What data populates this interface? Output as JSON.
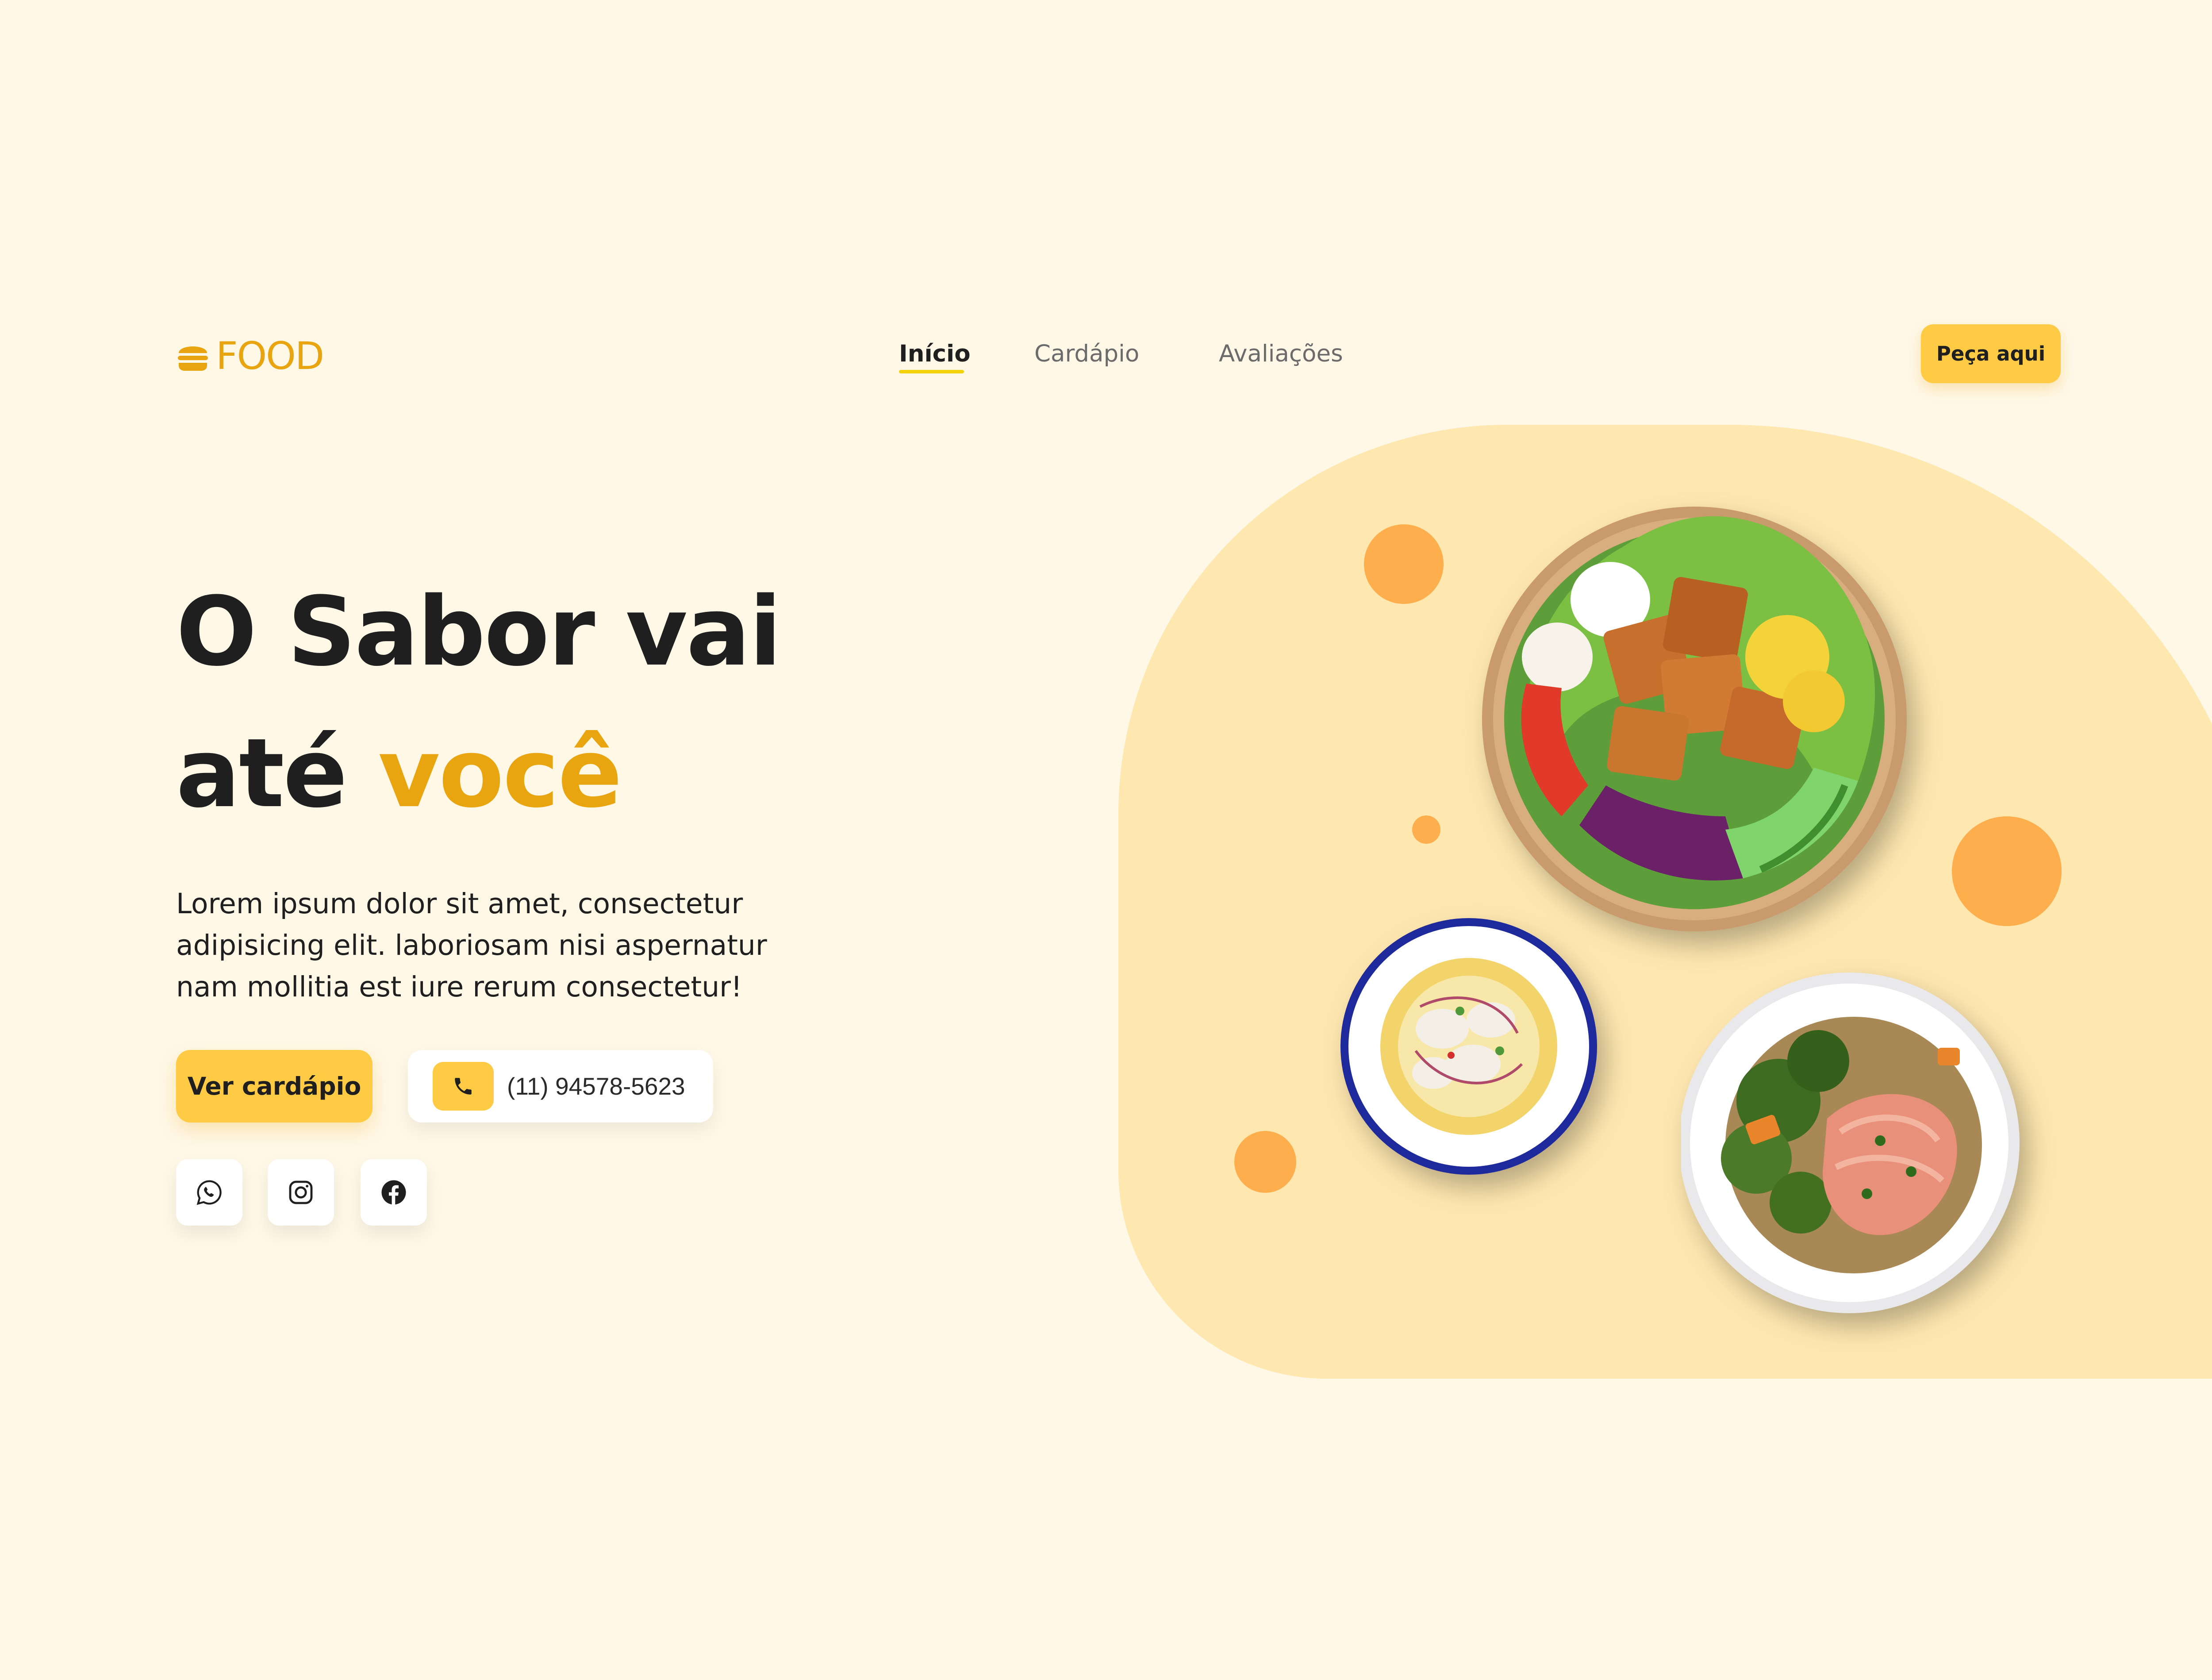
{
  "header": {
    "logo_text": "FOOD",
    "nav": [
      {
        "label": "Início",
        "active": true
      },
      {
        "label": "Cardápio",
        "active": false
      },
      {
        "label": "Avaliações",
        "active": false
      }
    ],
    "cta_label": "Peça aqui"
  },
  "hero": {
    "title_line1": "O Sabor vai",
    "title_line2_plain": "até ",
    "title_line2_accent": "você",
    "description": "Lorem ipsum dolor sit amet, consectetur adipisicing elit. laboriosam nisi aspernatur nam mollitia est iure rerum consectetur!",
    "menu_button_label": "Ver cardápio",
    "phone_number": "(11) 94578-5623"
  },
  "social": [
    {
      "icon": "whatsapp-icon"
    },
    {
      "icon": "instagram-icon"
    },
    {
      "icon": "facebook-icon"
    }
  ],
  "colors": {
    "background": "#FFF8E7",
    "accent": "#FFCB44",
    "accent_text": "#E8A50F",
    "blob": "#FFE8B0",
    "dots": "#FFAE4D",
    "nav_underline": "#F4D20C"
  }
}
